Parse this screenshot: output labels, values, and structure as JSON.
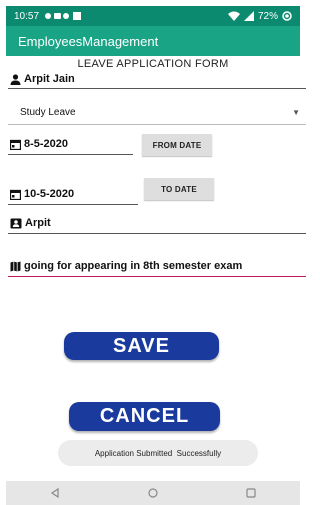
{
  "status_bar": {
    "time": "10:57",
    "battery": "72%"
  },
  "app_bar": {
    "title": "EmployeesManagement"
  },
  "form": {
    "title": "LEAVE APPLICATION FORM",
    "employee_name": "Arpit Jain",
    "leave_type": "Study Leave",
    "from_date_value": "8-5-2020",
    "from_date_button": "FROM DATE",
    "to_date_value": "10-5-2020",
    "to_date_button": "TO DATE",
    "approver": "Arpit",
    "reason": "going for appearing in 8th semester exam",
    "save_label": "SAVE",
    "cancel_label": "CANCEL"
  },
  "toast": {
    "message": "Application Submitted  Successfully"
  },
  "colors": {
    "status": "#0b8a70",
    "appbar": "#19a486",
    "button": "#1a3a9e",
    "accent_line": "#c2185b"
  }
}
